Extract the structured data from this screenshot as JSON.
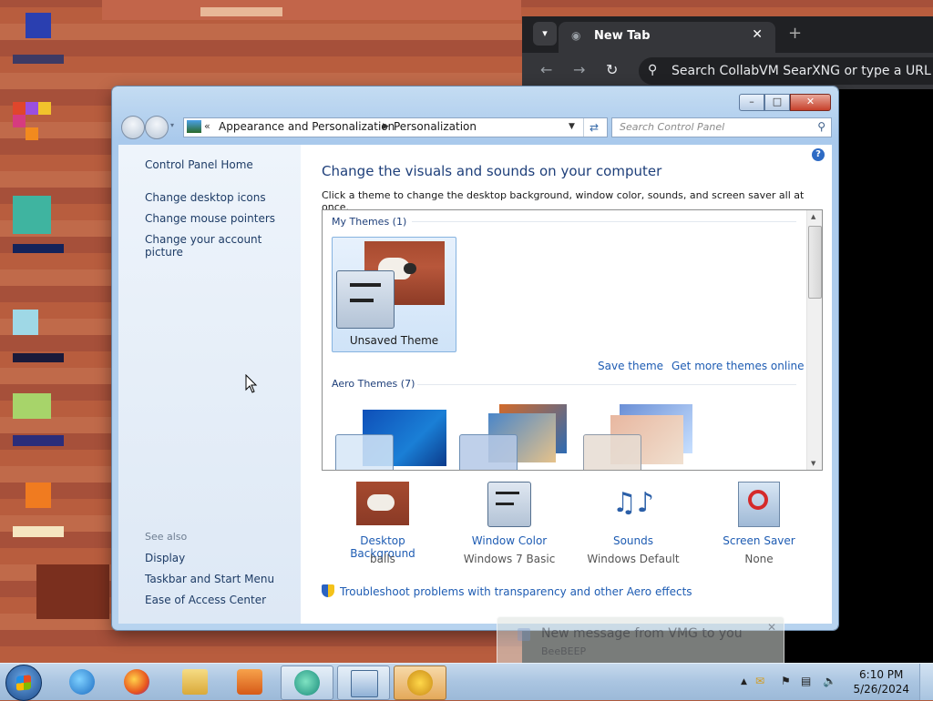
{
  "browser": {
    "tab_title": "New Tab",
    "omnibox_placeholder": "Search CollabVM SearXNG or type a URL"
  },
  "window": {
    "breadcrumb": [
      "Appearance and Personalization",
      "Personalization"
    ],
    "search_placeholder": "Search Control Panel",
    "sidebar": {
      "home": "Control Panel Home",
      "links": [
        "Change desktop icons",
        "Change mouse pointers",
        "Change your account picture"
      ],
      "see_also_label": "See also",
      "see_also": [
        "Display",
        "Taskbar and Start Menu",
        "Ease of Access Center"
      ]
    },
    "main": {
      "title": "Change the visuals and sounds on your computer",
      "subtitle": "Click a theme to change the desktop background, window color, sounds, and screen saver all at once.",
      "my_themes_header": "My Themes (1)",
      "unsaved_theme": "Unsaved Theme",
      "save_theme": "Save theme",
      "get_more_themes": "Get more themes online",
      "aero_themes_header": "Aero Themes (7)",
      "bottom_items": [
        {
          "label": "Desktop Background",
          "value": "balls"
        },
        {
          "label": "Window Color",
          "value": "Windows 7 Basic"
        },
        {
          "label": "Sounds",
          "value": "Windows Default"
        },
        {
          "label": "Screen Saver",
          "value": "None"
        }
      ],
      "troubleshoot": "Troubleshoot problems with transparency and other Aero effects"
    }
  },
  "notification": {
    "title": "New message from VMG to you",
    "sender": "BeeBEEP"
  },
  "taskbar": {
    "time": "6:10 PM",
    "date": "5/26/2024"
  }
}
